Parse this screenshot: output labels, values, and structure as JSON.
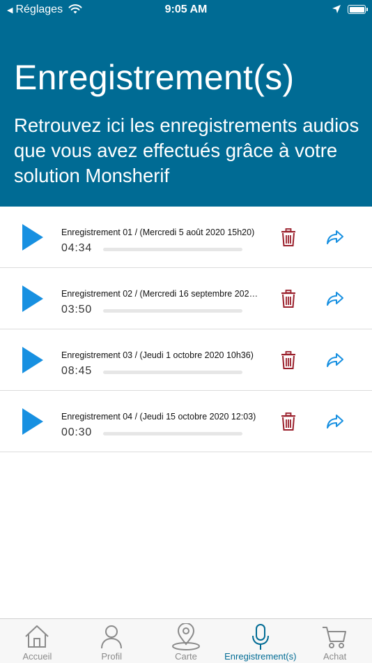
{
  "status_bar": {
    "back_label": "Réglages",
    "time": "9:05 AM"
  },
  "header": {
    "title": "Enregistrement(s)",
    "subtitle": "Retrouvez ici les enregistrements audios que vous avez effectués grâce à votre solution Monsherif",
    "background_color": "#006b94"
  },
  "recordings": [
    {
      "name": "Enregistrement 01 / (Mercredi 5 août 2020 15h20)",
      "duration": "04:34",
      "progress": 0
    },
    {
      "name": "Enregistrement 02 / (Mercredi 16 septembre 2020...",
      "duration": "03:50",
      "progress": 0
    },
    {
      "name": "Enregistrement 03 / (Jeudi 1 octobre 2020 10h36)",
      "duration": "08:45",
      "progress": 0
    },
    {
      "name": "Enregistrement 04 / (Jeudi 15 octobre 2020 12:03)",
      "duration": "00:30",
      "progress": 0
    }
  ],
  "colors": {
    "play": "#1790e1",
    "trash": "#9a1f2b",
    "share": "#1790e1",
    "active_tab": "#006b94"
  },
  "tab_bar": {
    "tabs": [
      {
        "label": "Accueil",
        "icon": "home-icon",
        "active": false
      },
      {
        "label": "Profil",
        "icon": "person-icon",
        "active": false
      },
      {
        "label": "Carte",
        "icon": "map-pin-icon",
        "active": false
      },
      {
        "label": "Enregistrement(s)",
        "icon": "microphone-icon",
        "active": true
      },
      {
        "label": "Achat",
        "icon": "cart-icon",
        "active": false
      }
    ]
  }
}
